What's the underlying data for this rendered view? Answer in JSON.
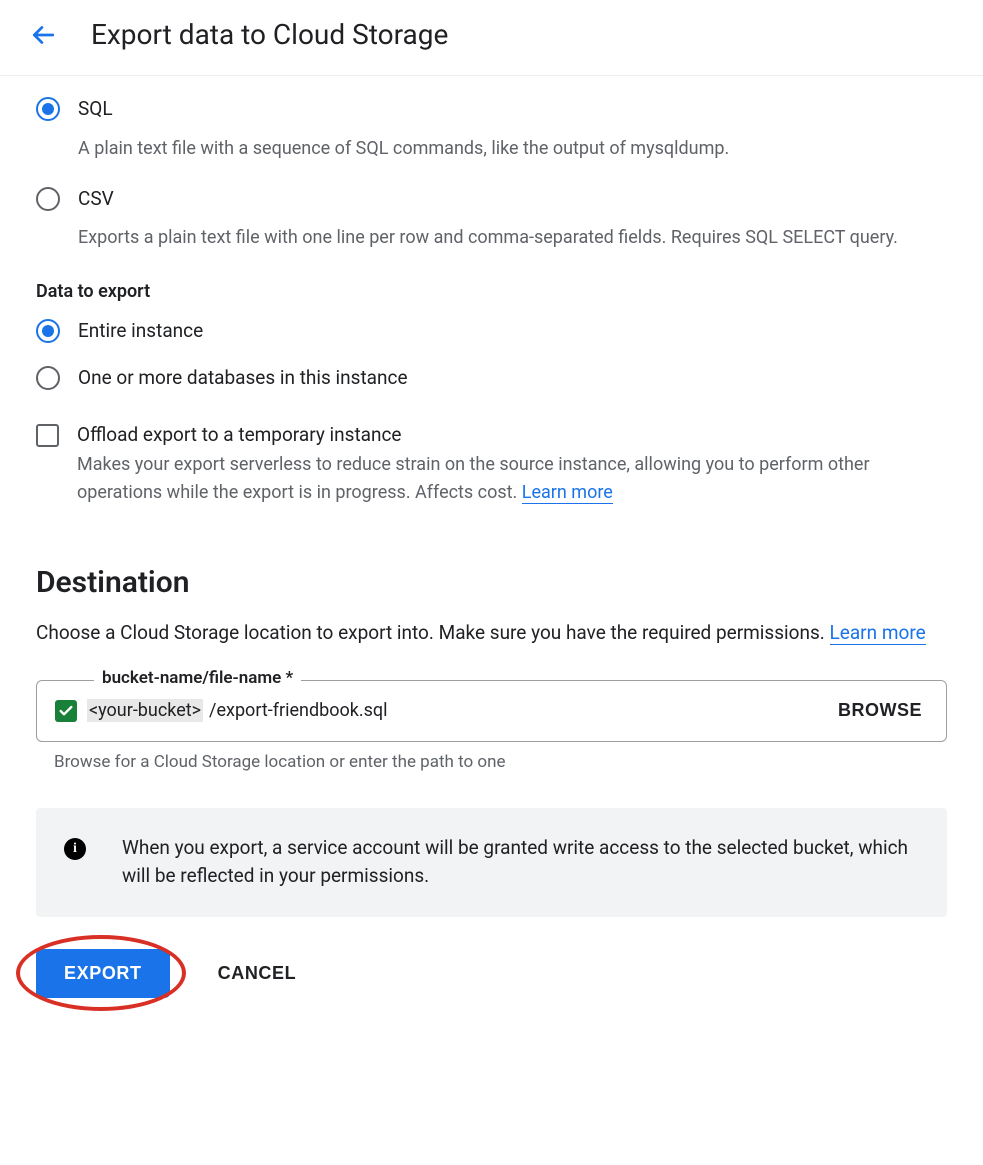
{
  "header": {
    "title": "Export data to Cloud Storage"
  },
  "format": {
    "options": [
      {
        "label": "SQL",
        "description": "A plain text file with a sequence of SQL commands, like the output of mysqldump.",
        "selected": true
      },
      {
        "label": "CSV",
        "description": "Exports a plain text file with one line per row and comma-separated fields. Requires SQL SELECT query.",
        "selected": false
      }
    ]
  },
  "data_to_export": {
    "heading": "Data to export",
    "options": [
      {
        "label": "Entire instance",
        "selected": true
      },
      {
        "label": "One or more databases in this instance",
        "selected": false
      }
    ]
  },
  "offload": {
    "label": "Offload export to a temporary instance",
    "description": "Makes your export serverless to reduce strain on the source instance, allowing you to perform other operations while the export is in progress. Affects cost. ",
    "learn_more": "Learn more",
    "checked": false
  },
  "destination": {
    "heading": "Destination",
    "description_pre": "Choose a Cloud Storage location to export into. Make sure you have the required permissions. ",
    "learn_more": "Learn more",
    "field_label": "bucket-name/file-name *",
    "bucket_placeholder": "<your-bucket>",
    "file_value": "/export-friendbook.sql",
    "browse_label": "BROWSE",
    "hint": "Browse for a Cloud Storage location or enter the path to one",
    "info_text": "When you export, a service account will be granted write access to the selected bucket, which will be reflected in your permissions."
  },
  "footer": {
    "export_label": "EXPORT",
    "cancel_label": "CANCEL"
  }
}
